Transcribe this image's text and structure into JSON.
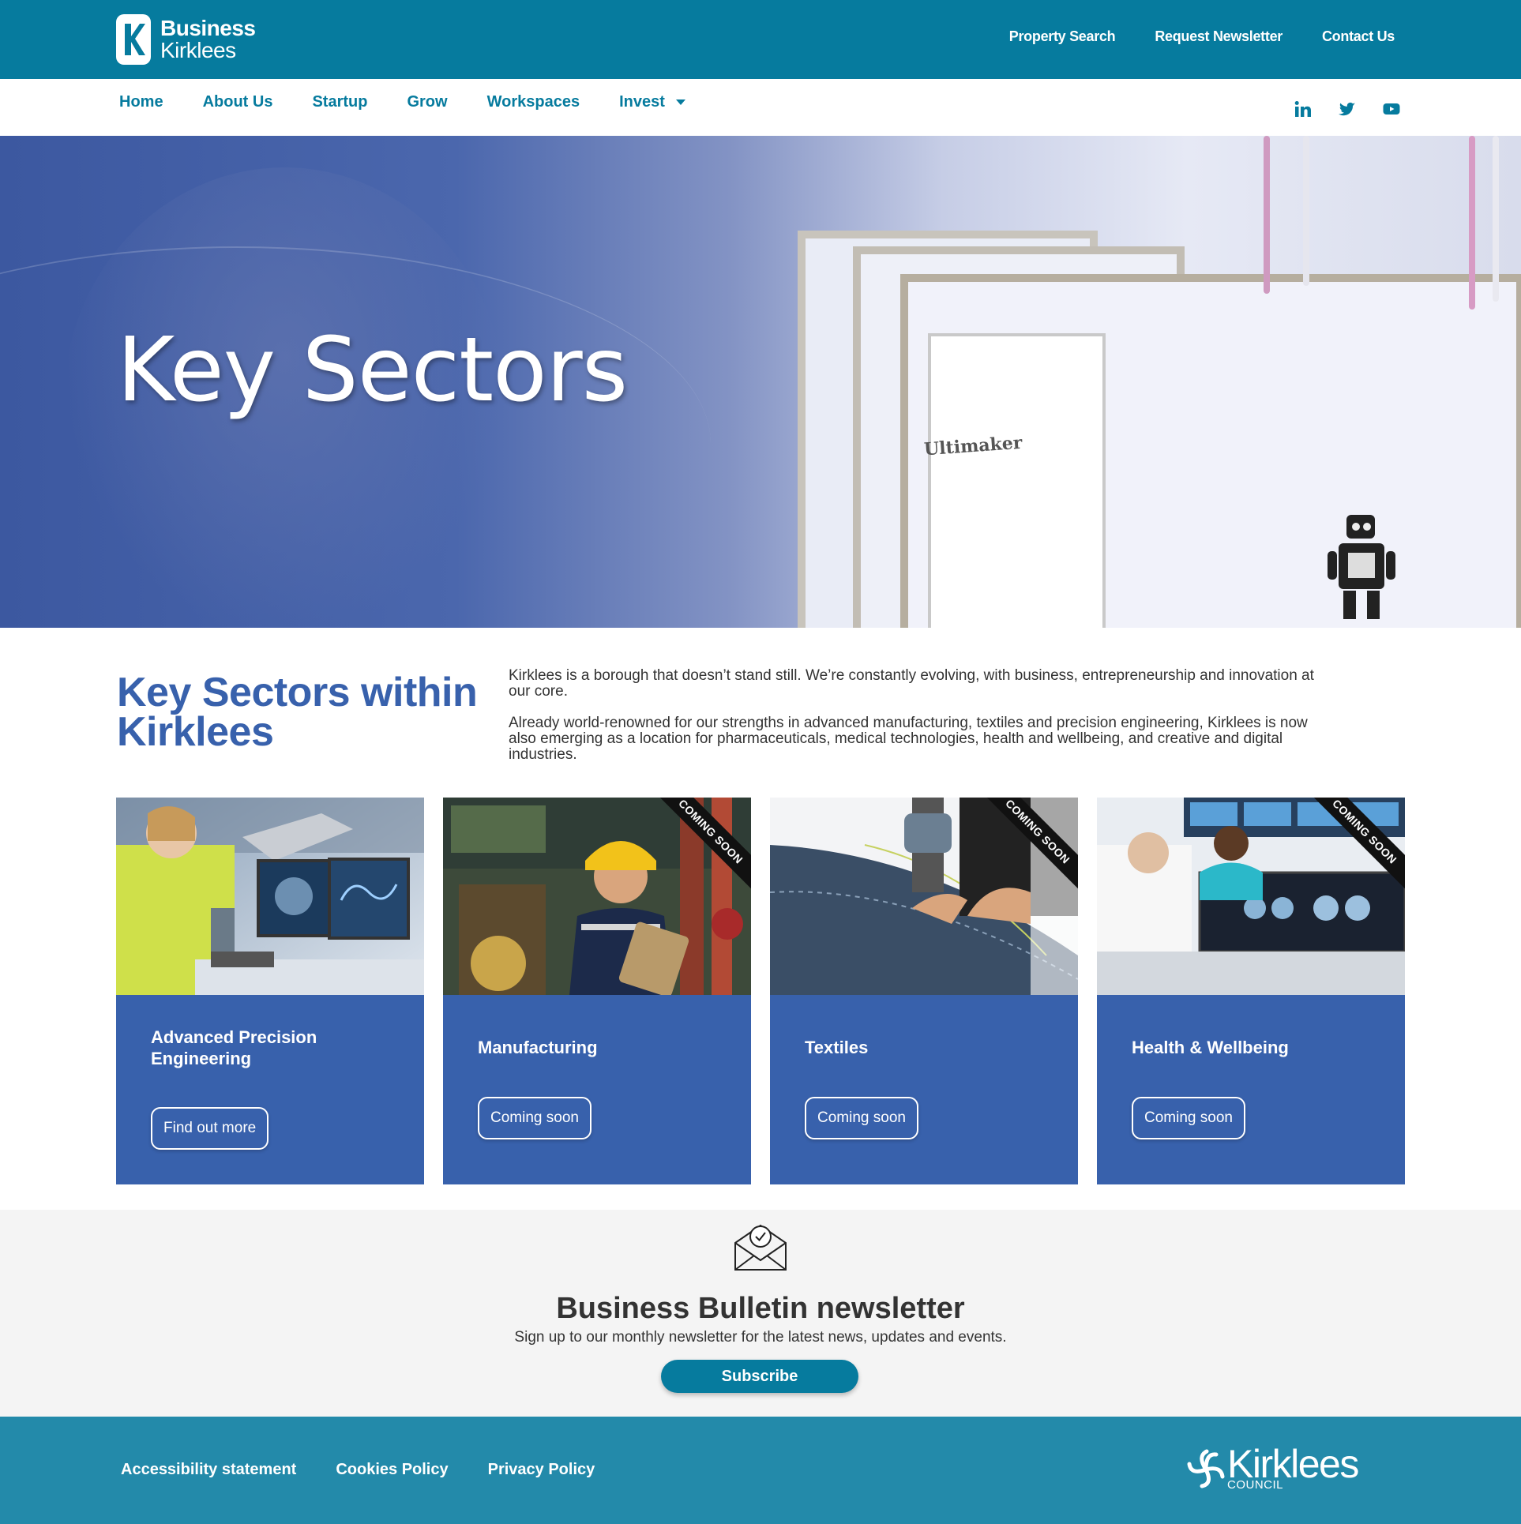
{
  "brand": {
    "line1": "Business",
    "line2": "Kirklees"
  },
  "top_links": [
    "Property Search",
    "Request Newsletter",
    "Contact Us"
  ],
  "nav": {
    "items": [
      "Home",
      "About Us",
      "Startup",
      "Grow",
      "Workspaces"
    ],
    "invest": "Invest"
  },
  "social": [
    "linkedin-icon",
    "twitter-icon",
    "youtube-icon"
  ],
  "hero": {
    "title": "Key Sectors",
    "image_label": "Ultimaker"
  },
  "intro": {
    "title": "Key Sectors within Kirklees",
    "p1": "Kirklees is a borough that doesn’t stand still. We’re constantly evolving, with business, entrepreneurship and innovation at our core.",
    "p2": "Already world-renowned for our strengths in advanced manufacturing, textiles and precision engineering, Kirklees is now also emerging as a location for pharmaceuticals, medical technologies, health and wellbeing, and creative and digital industries."
  },
  "cards": [
    {
      "title": "Advanced Precision Engineering",
      "button": "Find out more"
    },
    {
      "title": "Manufacturing",
      "button": "Coming soon",
      "ribbon": "COMING SOON"
    },
    {
      "title": "Textiles",
      "button": "Coming soon",
      "ribbon": "COMING SOON"
    },
    {
      "title": "Health & Wellbeing",
      "button": "Coming soon",
      "ribbon": "COMING SOON"
    }
  ],
  "newsletter": {
    "icon": "envelope-check-icon",
    "title": "Business Bulletin newsletter",
    "text": "Sign up to our monthly newsletter for the latest news, updates and events.",
    "button": "Subscribe"
  },
  "footer": {
    "links": [
      "Accessibility statement",
      "Cookies Policy",
      "Privacy Policy"
    ],
    "council_name": "Kirklees",
    "council_sub": "COUNCIL"
  },
  "colors": {
    "teal": "#067b9e",
    "footer": "#238aaa",
    "card_blue": "#3861ac"
  }
}
